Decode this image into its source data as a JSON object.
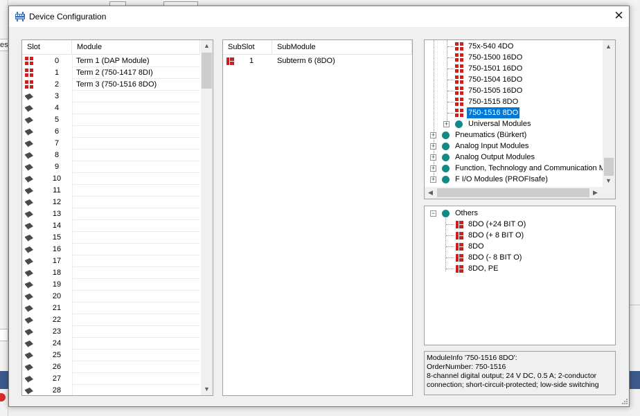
{
  "window": {
    "title": "Device Configuration",
    "close_glyph": "✕",
    "icon": "device-config-icon"
  },
  "background": {
    "left_field_text": "es"
  },
  "slot_table": {
    "headers": {
      "slot": "Slot",
      "module": "Module"
    },
    "rows": [
      {
        "slot": "0",
        "module": "Term 1 (DAP Module)",
        "icon": "module-icon"
      },
      {
        "slot": "1",
        "module": "Term 2 (750-1417 8DI)",
        "icon": "module-icon"
      },
      {
        "slot": "2",
        "module": "Term 3 (750-1516 8DO)",
        "icon": "module-icon"
      },
      {
        "slot": "3",
        "module": "",
        "icon": "empty-slot-icon"
      },
      {
        "slot": "4",
        "module": "",
        "icon": "empty-slot-icon"
      },
      {
        "slot": "5",
        "module": "",
        "icon": "empty-slot-icon"
      },
      {
        "slot": "6",
        "module": "",
        "icon": "empty-slot-icon"
      },
      {
        "slot": "7",
        "module": "",
        "icon": "empty-slot-icon"
      },
      {
        "slot": "8",
        "module": "",
        "icon": "empty-slot-icon"
      },
      {
        "slot": "9",
        "module": "",
        "icon": "empty-slot-icon"
      },
      {
        "slot": "10",
        "module": "",
        "icon": "empty-slot-icon"
      },
      {
        "slot": "11",
        "module": "",
        "icon": "empty-slot-icon"
      },
      {
        "slot": "12",
        "module": "",
        "icon": "empty-slot-icon"
      },
      {
        "slot": "13",
        "module": "",
        "icon": "empty-slot-icon"
      },
      {
        "slot": "14",
        "module": "",
        "icon": "empty-slot-icon"
      },
      {
        "slot": "15",
        "module": "",
        "icon": "empty-slot-icon"
      },
      {
        "slot": "16",
        "module": "",
        "icon": "empty-slot-icon"
      },
      {
        "slot": "17",
        "module": "",
        "icon": "empty-slot-icon"
      },
      {
        "slot": "18",
        "module": "",
        "icon": "empty-slot-icon"
      },
      {
        "slot": "19",
        "module": "",
        "icon": "empty-slot-icon"
      },
      {
        "slot": "20",
        "module": "",
        "icon": "empty-slot-icon"
      },
      {
        "slot": "21",
        "module": "",
        "icon": "empty-slot-icon"
      },
      {
        "slot": "22",
        "module": "",
        "icon": "empty-slot-icon"
      },
      {
        "slot": "23",
        "module": "",
        "icon": "empty-slot-icon"
      },
      {
        "slot": "24",
        "module": "",
        "icon": "empty-slot-icon"
      },
      {
        "slot": "25",
        "module": "",
        "icon": "empty-slot-icon"
      },
      {
        "slot": "26",
        "module": "",
        "icon": "empty-slot-icon"
      },
      {
        "slot": "27",
        "module": "",
        "icon": "empty-slot-icon"
      },
      {
        "slot": "28",
        "module": "",
        "icon": "empty-slot-icon"
      }
    ]
  },
  "subslot_table": {
    "headers": {
      "subslot": "SubSlot",
      "submodule": "SubModule"
    },
    "rows": [
      {
        "subslot": "1",
        "submodule": "Subterm 6 (8DO)",
        "icon": "submodule-icon"
      }
    ]
  },
  "catalog_tree": {
    "items": [
      {
        "label": "75x-540 4DO",
        "level": 2,
        "icon": "module-icon",
        "selected": false
      },
      {
        "label": "750-1500 16DO",
        "level": 2,
        "icon": "module-icon",
        "selected": false
      },
      {
        "label": "750-1501 16DO",
        "level": 2,
        "icon": "module-icon",
        "selected": false
      },
      {
        "label": "750-1504 16DO",
        "level": 2,
        "icon": "module-icon",
        "selected": false
      },
      {
        "label": "750-1505 16DO",
        "level": 2,
        "icon": "module-icon",
        "selected": false
      },
      {
        "label": "750-1515 8DO",
        "level": 2,
        "icon": "module-icon",
        "selected": false
      },
      {
        "label": "750-1516 8DO",
        "level": 2,
        "icon": "module-icon",
        "selected": true
      },
      {
        "label": "Universal Modules",
        "level": 1,
        "icon": "folder-dot-icon",
        "expander": "+"
      },
      {
        "label": "Pneumatics (Bürkert)",
        "level": 0,
        "icon": "folder-dot-icon",
        "expander": "+"
      },
      {
        "label": "Analog Input Modules",
        "level": 0,
        "icon": "folder-dot-icon",
        "expander": "+"
      },
      {
        "label": "Analog Output Modules",
        "level": 0,
        "icon": "folder-dot-icon",
        "expander": "+"
      },
      {
        "label": "Function, Technology and Communication M",
        "level": 0,
        "icon": "folder-dot-icon",
        "expander": "+"
      },
      {
        "label": "F I/O Modules (PROFIsafe)",
        "level": 0,
        "icon": "folder-dot-icon",
        "expander": "+"
      }
    ]
  },
  "submodule_tree": {
    "root": {
      "label": "Others",
      "expander": "−"
    },
    "items": [
      {
        "label": "8DO (+24 BIT O)",
        "icon": "submodule-icon"
      },
      {
        "label": "8DO (+ 8 BIT O)",
        "icon": "submodule-icon"
      },
      {
        "label": "8DO",
        "icon": "submodule-icon"
      },
      {
        "label": "8DO (- 8 BIT O)",
        "icon": "submodule-icon"
      },
      {
        "label": "8DO, PE",
        "icon": "submodule-icon"
      }
    ]
  },
  "module_info": {
    "line1": "ModuleInfo '750-1516 8DO':",
    "line2": "OrderNumber: 750-1516",
    "line3": "8-channel digital output; 24 V DC, 0.5 A; 2-conductor",
    "line4": "connection; short-circuit-protected; low-side switching"
  },
  "scroll": {
    "up": "▲",
    "down": "▼",
    "left": "◀",
    "right": "▶"
  },
  "colors": {
    "selection": "#0078d7",
    "module_red": "#cc1f1f",
    "folder_teal": "#138a8a"
  }
}
